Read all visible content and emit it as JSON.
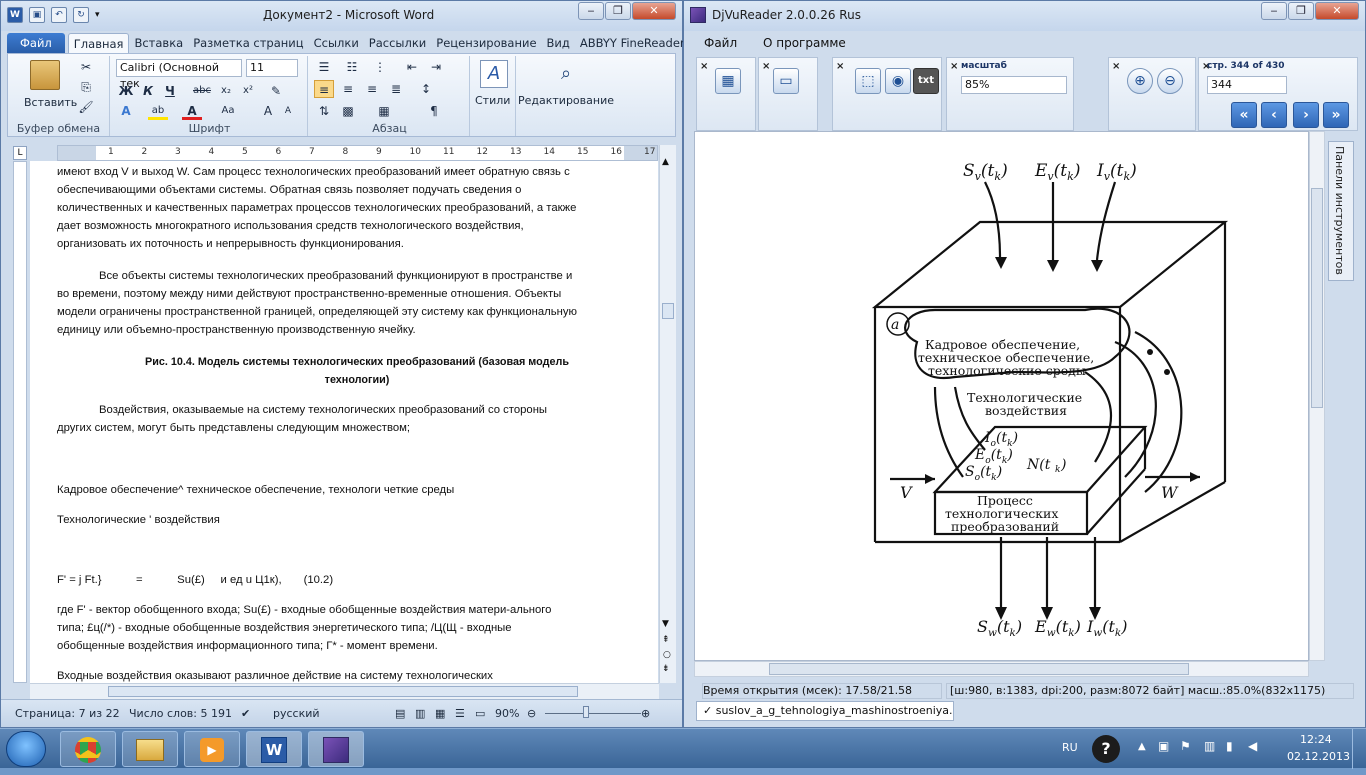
{
  "word": {
    "title": "Документ2 - Microsoft Word",
    "app_icon": "W",
    "tabs": [
      {
        "label": "Файл"
      },
      {
        "label": "Главная"
      },
      {
        "label": "Вставка"
      },
      {
        "label": "Разметка страниц"
      },
      {
        "label": "Ссылки"
      },
      {
        "label": "Рассылки"
      },
      {
        "label": "Рецензирование"
      },
      {
        "label": "Вид"
      },
      {
        "label": "ABBYY FineReader"
      }
    ],
    "ribbon": {
      "paste_label": "Вставить",
      "clipboard_label": "Буфер обмена",
      "font_name": "Calibri (Основной тек",
      "font_size": "11",
      "font_group_label": "Шрифт",
      "paragraph_label": "Абзац",
      "styles_label": "Стили",
      "editing_label": "Редактирование"
    },
    "ruler_numbers": [
      "1",
      "2",
      "3",
      "4",
      "5",
      "6",
      "7",
      "8",
      "9",
      "10",
      "11",
      "12",
      "13",
      "14",
      "15",
      "16",
      "17"
    ],
    "paragraphs": [
      "имеют вход V и выход W. Сам процесс технологических преобразований имеет обратную связь с",
      "обеспечивающими объектами системы. Обратная связь позволяет подучать сведения о",
      "количественных и качественных параметрах процессов технологических преобразований, а также",
      "дает возможность многократного использования средств технологического воздействия,",
      "организовать их поточность и непрерывность функционирования.",
      "Все объекты системы технологических преобразований функционируют в пространстве и",
      "во времени, поэтому между ними действуют пространственно-временные отношения. Объекты",
      "модели ограничены пространственной границей, определяющей эту систему как функциональную",
      "единицу или объемно-пространственную производственную ячейку.",
      "Рис. 10.4. Модель системы технологических  преобразований (базовая  модель",
      "технологии)",
      "Воздействия, оказываемые на систему технологических преобразований со стороны",
      "других систем, могут быть представлены следующим множеством;",
      "Кадровое обеспечение^ техническое обеспечение, технологи четкие среды",
      "Технологические ' воздействия",
      "F' = j Ft.}           =           Su(£)     и ед u Ц1к),       (10.2)",
      "где F' - вектор обобщенного входа; Su(£) - входные обобщенные воздействия матери-ального",
      "типа; £ц(/*) - входные обобщенные воздействия энергетического типа; /Ц(Щ - входные",
      "обобщенные воздействия информационного типа; Г* - момент времени.",
      "Входные воздействия оказывают различное действие на систему технологических"
    ],
    "status": {
      "page": "Страница: 7 из 22",
      "words": "Число слов: 5 191",
      "language": "русский",
      "zoom": "90%"
    }
  },
  "djvu": {
    "title": "DjVuReader 2.0.0.26 Rus",
    "menu": [
      "Файл",
      "О программе"
    ],
    "scale_label": "масштаб",
    "scale_value": "85%",
    "page_label": "стр. 344 of 430",
    "page_value": "344",
    "panel_label": "Панели инструментов",
    "status_left": "Время открытия (мсек): 17.58/21.58",
    "status_right": "[ш:980, в:1383, dpi:200, разм:8072 байт] масш.:85.0%(832x1175)",
    "doc_tab": "suslov_a_g_tehnologiya_mashinostroeniya.djvu",
    "figure": {
      "box_text": [
        "Кадровое обеспечение,",
        "техническое обеспечение,",
        "технологические среды"
      ],
      "process_text": [
        "Процесс",
        "технологических",
        "преобразований"
      ],
      "impact_text": [
        "Технологические",
        "воздействия"
      ],
      "a_label": "a",
      "v_label": "V",
      "w_label": "W",
      "n_label": "N(t",
      "top_labels": [
        "S",
        "E",
        "I"
      ],
      "mid_labels": [
        "I",
        "E",
        "S"
      ],
      "bottom_labels": [
        "S",
        "E",
        "I"
      ],
      "t_label": "(t",
      "k_sub": "k",
      "close_paren": ")",
      "sub_v": "v",
      "sub_o": "o",
      "sub_w": "w"
    }
  },
  "taskbar": {
    "lang": "RU",
    "time": "12:24",
    "date": "02.12.2013"
  }
}
